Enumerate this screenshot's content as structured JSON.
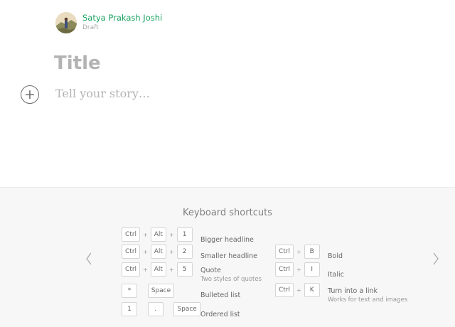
{
  "author": {
    "name": "Satya Prakash Joshi",
    "status": "Draft"
  },
  "editor": {
    "title_placeholder": "Title",
    "story_placeholder": "Tell your story…",
    "add_icon": "plus-icon"
  },
  "shortcuts": {
    "heading": "Keyboard shortcuts",
    "left": [
      {
        "keys": [
          "Ctrl",
          "Alt",
          "1"
        ],
        "label": "Bigger headline",
        "sub": ""
      },
      {
        "keys": [
          "Ctrl",
          "Alt",
          "2"
        ],
        "label": "Smaller headline",
        "sub": ""
      },
      {
        "keys": [
          "Ctrl",
          "Alt",
          "5"
        ],
        "label": "Quote",
        "sub": "Two styles of quotes"
      },
      {
        "keys": [
          "*",
          "Space"
        ],
        "label": "Bulleted list",
        "sub": ""
      },
      {
        "keys": [
          "1",
          ".",
          "Space"
        ],
        "label": "Ordered list",
        "sub": ""
      }
    ],
    "right": [
      {
        "keys": [
          "Ctrl",
          "B"
        ],
        "label": "Bold",
        "sub": ""
      },
      {
        "keys": [
          "Ctrl",
          "I"
        ],
        "label": "Italic",
        "sub": ""
      },
      {
        "keys": [
          "Ctrl",
          "K"
        ],
        "label": "Turn into a link",
        "sub": "Works for text and images"
      }
    ],
    "prev_icon": "chevron-left-icon",
    "next_icon": "chevron-right-icon"
  },
  "colors": {
    "accent": "#1aa361",
    "placeholder": "#b3b3b3",
    "panel_bg": "#f7f7f7"
  }
}
